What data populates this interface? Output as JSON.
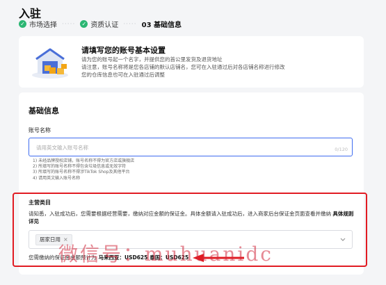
{
  "page": {
    "title": "入驻"
  },
  "steps": [
    {
      "label": "市场选择",
      "status": "done"
    },
    {
      "label": "资质认证",
      "status": "done"
    },
    {
      "label": "03 基础信息",
      "status": "current"
    }
  ],
  "intro": {
    "title": "请填写您的账号基本设置",
    "lines": [
      "请为您的账号起一个名字，并提供您的首公里发货及退货地址",
      "请注意，账号名称将是您各店铺的默认店铺名，您可在入驻通过后对各店铺名称进行修改",
      "您的仓库信息也可在入驻通过后调整"
    ]
  },
  "basic_info": {
    "title": "基础信息",
    "account_name": {
      "label": "账号名称",
      "placeholder": "请用英文输入账号名称",
      "counter": "0/120"
    },
    "rules": [
      "1) 未经品牌授权店铺，账号名称不得为官方店或旗舰店",
      "2) 所填写的账号名称不得包含垃圾信息或无效字符",
      "3) 所填写的账号名称不得涉TikTok Shop及其他平台",
      "4) 请用英文输入账号名称"
    ],
    "category": {
      "label": "主营类目",
      "desc_text": "请知悉，入驻成功后，您需要根据经营需要，缴纳对应金额的保证金。具体金额请入驻成功后，进入商家后台保证金页面查看并缴纳",
      "rules_link": "具体规则详见",
      "selected_tag": "居家日用",
      "tag_close": "×"
    },
    "deposit": {
      "prefix": "您需缴纳的保证金金额预计为",
      "malaysia": "马来西亚：USD625",
      "sep": "泰国：USD625"
    }
  },
  "watermark": "微信号：muhuanidc",
  "colors": {
    "accent": "#3d6bf0",
    "success": "#2bb673",
    "highlight": "#e11b22"
  }
}
